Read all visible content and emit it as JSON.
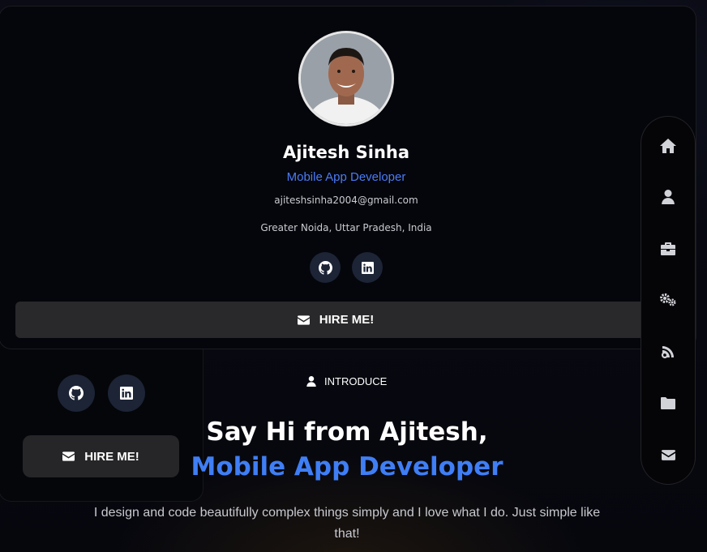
{
  "profile": {
    "name": "Ajitesh Sinha",
    "role": "Mobile App Developer",
    "email": "ajiteshsinha2004@gmail.com",
    "location": "Greater Noida, Uttar Pradesh, India",
    "hire_label": "HIRE ME!",
    "social": [
      "github-icon",
      "linkedin-icon"
    ]
  },
  "background_card": {
    "hire_label": "HIRE ME!"
  },
  "intro": {
    "label": "INTRODUCE",
    "headline_line1": "Say Hi from Ajitesh,",
    "headline_line2": "Mobile App Developer",
    "description": "I design and code beautifully complex things simply and I love what I do. Just simple like that!"
  },
  "nav": [
    "home-icon",
    "user-icon",
    "briefcase-icon",
    "cogs-icon",
    "blog-icon",
    "folder-icon",
    "envelope-icon"
  ],
  "colors": {
    "accent": "#3f7ef5",
    "role": "#4a7bf7",
    "button": "#29292b",
    "social_bg": "#1c2436"
  }
}
